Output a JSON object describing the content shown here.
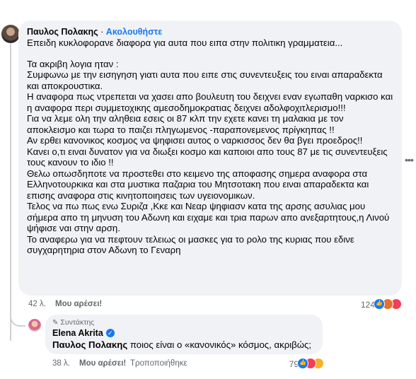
{
  "main_comment": {
    "author": "Παυλος Πολακης",
    "separator": "·",
    "follow_label": "Ακολουθήστε",
    "text_first": "Επειδη κυκλοφορανε διαφορα για αυτα που ειπα στην πολιτικη γραμματεια...",
    "text_body": "Τα ακριβη λογια ηταν :\nΣυμφωνω με την εισηγηση γιατι αυτα που ειπε στις συνεντευξεις του ειναι απαραδεκτα και αποκρουστικα.\nΗ αναφορα πως ντρεπεται να χασει απο βουλευτη του δειχνει εναν εγωπαθη ναρκισο και η αναφορα περι συμμετοχικης αμεσοδημοκρατιας δειχνει αδολφοχιτλερισμο!!!\nΓια να λεμε ολη την αληθεια εσεις οι 87 κλπ την εχετε κανει τη μαλακια με τον αποκλεισμο και τωρα το παιζει πληγωμενος -παραπονεμενος πρίγκηπας !!\nΑν ερθει κανονικος κοσμος να ψηφισει αυτος ο ναρκισσος δεν θα βγει προεδρος!!\nΚανει ο,τι ειναι δυνατον για να διωξει κοσμο και καποιοι απο τους 87 με τις συνεντευξεις τους κανουν το ιδιο !!\nΘελω οπωσδηποτε να προστεθει στο κειμενο της αποφασης σημερα αναφορα στα Ελληνοτουρκικα και στα μυστικα παζαρια του Μητσοτακη που ειναι απαραδεκτα και επισης αναφορα στις κινητοποιησεις των υγειονομικων.\nΤελος να πω πως ενω Συριζα ,Κκε και Νεαρ ψηφιασν κατα της αρσης ασυλιας μου σήμερα απο τη μηνυση του Αδωνη και ειχαμε και τρια παρων απο ανεξαρτητους,η Λινού ψήφισε ναι στην αρση.\nΤο αναφερω για να πεφτουν τελειως οι μασκες για το ρολο της κυριας που εδινε συγχαρητηρια στον Αδωνη το Γεναρη",
    "time": "42 λ.",
    "like_label": "Μου αρέσει!",
    "reaction_count": "124",
    "reactions": [
      "like-icon",
      "angry-icon",
      "love-icon"
    ]
  },
  "reply": {
    "badge": "Συντάκτης",
    "author": "Elena Akrita",
    "mention": "Παυλος Πολακης",
    "text": " ποιος είναι ο «κανονικός» κόσμος, ακριβώς;",
    "time": "38 λ.",
    "like_label": "Μου αρέσει!",
    "edited_label": "Τροποποιήθηκε",
    "reaction_count": "79",
    "reactions": [
      "like-icon",
      "love-icon",
      "haha-icon"
    ]
  },
  "more_icon": "more-options-icon",
  "colors": {
    "accent": "#1877f2",
    "bubble": "#f0f2f5",
    "muted": "#65676b"
  }
}
